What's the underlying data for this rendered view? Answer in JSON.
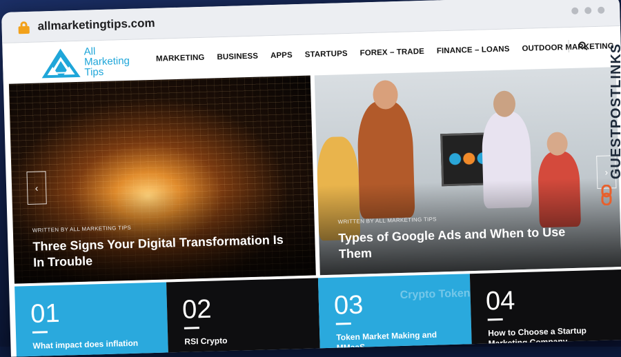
{
  "browser": {
    "url": "allmarketingtips.com"
  },
  "site": {
    "logo_line1": "All",
    "logo_line2": "Marketing",
    "logo_line3": "Tips",
    "brand_color": "#1fa6d9"
  },
  "nav": {
    "items": [
      {
        "label": "MARKETING"
      },
      {
        "label": "BUSINESS"
      },
      {
        "label": "APPS"
      },
      {
        "label": "STARTUPS"
      },
      {
        "label": "FOREX – TRADE"
      },
      {
        "label": "FINANCE – LOANS"
      },
      {
        "label": "OUTDOOR MARKETING"
      }
    ],
    "search_icon": "search-icon"
  },
  "slides": [
    {
      "written": "WRITTEN BY ALL MARKETING TIPS",
      "title": "Three Signs Your Digital Transformation Is In Trouble"
    },
    {
      "written": "WRITTEN BY ALL MARKETING TIPS",
      "title": "Types of Google Ads and When to Use Them"
    }
  ],
  "slider_controls": {
    "prev": "‹",
    "next": "›"
  },
  "cards": [
    {
      "num": "01",
      "title": "What impact does inflation",
      "ghost": "",
      "color": "#2aa9dd"
    },
    {
      "num": "02",
      "title": "RSI Crypto",
      "ghost": "",
      "color": "#0e0e10"
    },
    {
      "num": "03",
      "title": "Token Market Making and MMaaS",
      "ghost": "Crypto Token",
      "color": "#2aa9dd"
    },
    {
      "num": "04",
      "title": "How to Choose a Startup Marketing Company",
      "ghost": "",
      "color": "#0e0e10"
    }
  ],
  "watermark": {
    "text": "GUESTPOSTLINKS",
    "accent": "#e8602c"
  }
}
